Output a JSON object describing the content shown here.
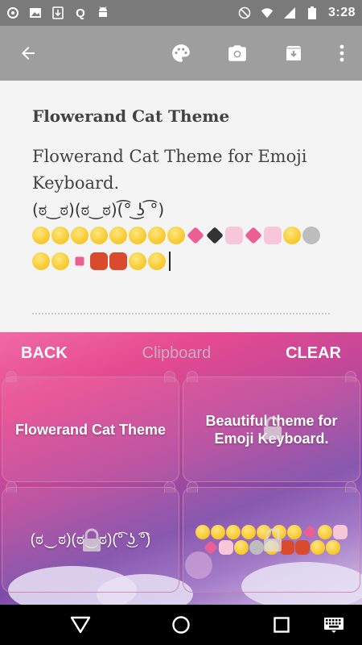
{
  "status_bar": {
    "time": "3:28",
    "left_icons": [
      "sync-icon",
      "image-icon",
      "download-icon",
      "q-app-icon",
      "android-icon"
    ],
    "right_icons": [
      "do-not-disturb-icon",
      "wifi-icon",
      "signal-icon",
      "battery-icon"
    ],
    "q_label": "Q"
  },
  "app_bar": {
    "actions": [
      "palette-icon",
      "camera-icon",
      "archive-icon",
      "more-icon"
    ]
  },
  "note": {
    "title": "Flowerand Cat Theme",
    "line1": "Flowerand Cat Theme for Emoji",
    "line2": "Keyboard.",
    "kaomoji": "(ಠ‿ಠ)(ಠ‿ಠ)(͡° ͜ʖ ͡°)"
  },
  "clipboard": {
    "back_label": "BACK",
    "title": "Clipboard",
    "clear_label": "CLEAR",
    "items": [
      {
        "text": "Flowerand Cat Theme",
        "locked": false
      },
      {
        "text": "Beautiful theme for Emoji Keyboard.",
        "locked": true
      },
      {
        "text": "(ಠ‿ಠ)(ಠ‿ಠ)(͡° ͜ʖ ͡°)",
        "locked": true
      },
      {
        "text": "",
        "locked": true
      }
    ]
  },
  "colors": {
    "status_bar": "#7a7a7a",
    "app_bar": "#9e9e9e",
    "accent_pink": "#e64a90"
  }
}
